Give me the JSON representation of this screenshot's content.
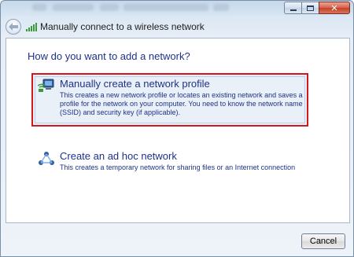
{
  "window": {
    "title": "Manually connect to a wireless network",
    "caption_close_glyph": "✕"
  },
  "page": {
    "heading": "How do you want to add a network?"
  },
  "options": [
    {
      "title": "Manually create a network profile",
      "description": "This creates a new network profile or locates an existing network and saves a profile for the network on your computer. You need to know the network name (SSID) and security key (if applicable).",
      "icon": "network-profile-icon",
      "highlighted": true
    },
    {
      "title": "Create an ad hoc network",
      "description": "This creates a temporary network for sharing files or an Internet connection",
      "icon": "ad-hoc-network-icon",
      "highlighted": false
    }
  ],
  "buttons": {
    "cancel_label": "Cancel"
  },
  "colors": {
    "link_blue": "#1e3287",
    "highlight_border": "#d4161f",
    "wifi_green": "#3a9a3a"
  }
}
